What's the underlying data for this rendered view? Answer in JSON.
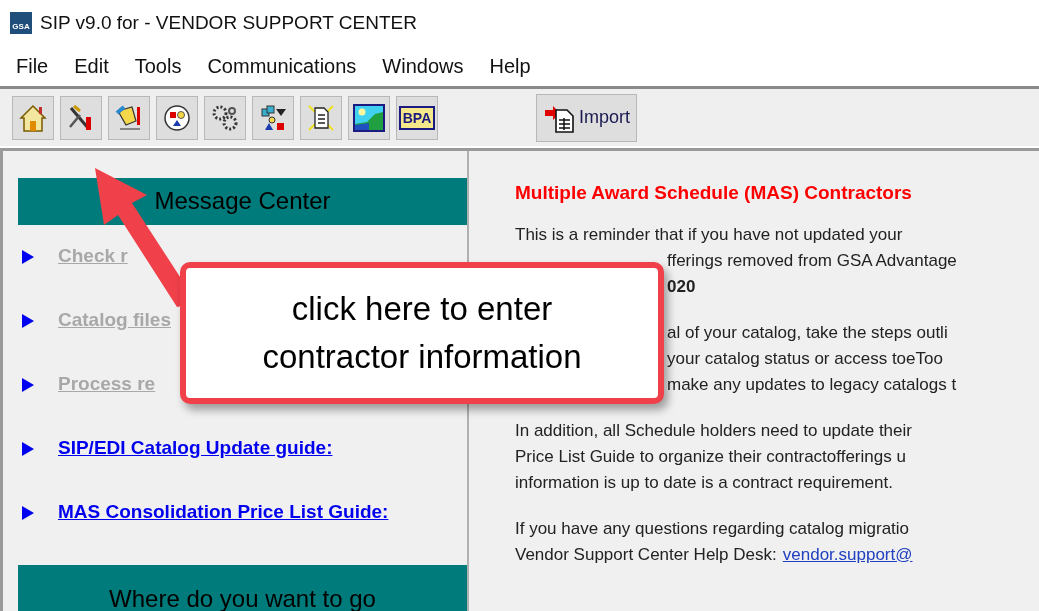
{
  "window": {
    "title": "SIP v9.0 for - VENDOR SUPPORT CENTER",
    "logo": "GSA"
  },
  "menu": [
    "File",
    "Edit",
    "Tools",
    "Communications",
    "Windows",
    "Help"
  ],
  "toolbar": {
    "buttons": [
      {
        "kind": "home"
      },
      {
        "kind": "tools"
      },
      {
        "kind": "hand"
      },
      {
        "kind": "circle"
      },
      {
        "kind": "gears"
      },
      {
        "kind": "shapes"
      },
      {
        "kind": "document"
      },
      {
        "kind": "landscape"
      },
      {
        "kind": "text",
        "label": "BPA"
      }
    ],
    "import_button": {
      "label": "Import"
    }
  },
  "message_center": {
    "title": "Message Center",
    "items": [
      {
        "label": "Check r",
        "disabled": true
      },
      {
        "label": "Catalog files",
        "disabled": true
      },
      {
        "label": "Process re",
        "disabled": true
      },
      {
        "label": "SIP/EDI Catalog Update guide:",
        "disabled": false
      },
      {
        "label": "MAS Consolidation Price List Guide:",
        "disabled": false
      }
    ]
  },
  "next_section": {
    "title": "Where do you want to go"
  },
  "notice": {
    "title": "Multiple Award Schedule (MAS) Contractors",
    "paragraphs": [
      [
        {
          "text": "This is a reminder that if you have not updated your",
          "kind": "full",
          "bold": false
        },
        {
          "text": "fferings removed from GSA Advantage",
          "kind": "covered",
          "bold": false
        },
        {
          "text": "020",
          "kind": "covered",
          "bold": true
        }
      ],
      [
        {
          "text": "al of your catalog, take the steps outli",
          "kind": "covered",
          "bold": false
        },
        {
          "text": "your catalog status or access toeToo",
          "kind": "covered",
          "bold": false
        },
        {
          "text": "make any updates to legacy catalogs t",
          "kind": "covered",
          "bold": false
        }
      ],
      [
        {
          "text": "In addition, all Schedule holders need to update their",
          "kind": "full",
          "bold": false
        },
        {
          "text": "Price List Guide to organize their contractofferings u",
          "kind": "full",
          "bold": false
        },
        {
          "text": "information is up to date is a contract requirement.",
          "kind": "full",
          "bold": false
        }
      ],
      [
        {
          "text": "If you have any questions regarding catalog migratio",
          "kind": "full",
          "bold": false
        },
        {
          "text": "Vendor Support Center Help Desk:",
          "kind": "full",
          "bold": false,
          "link": "vendor.support@"
        }
      ]
    ]
  },
  "callout": {
    "text": "click here to enter contractor information"
  }
}
